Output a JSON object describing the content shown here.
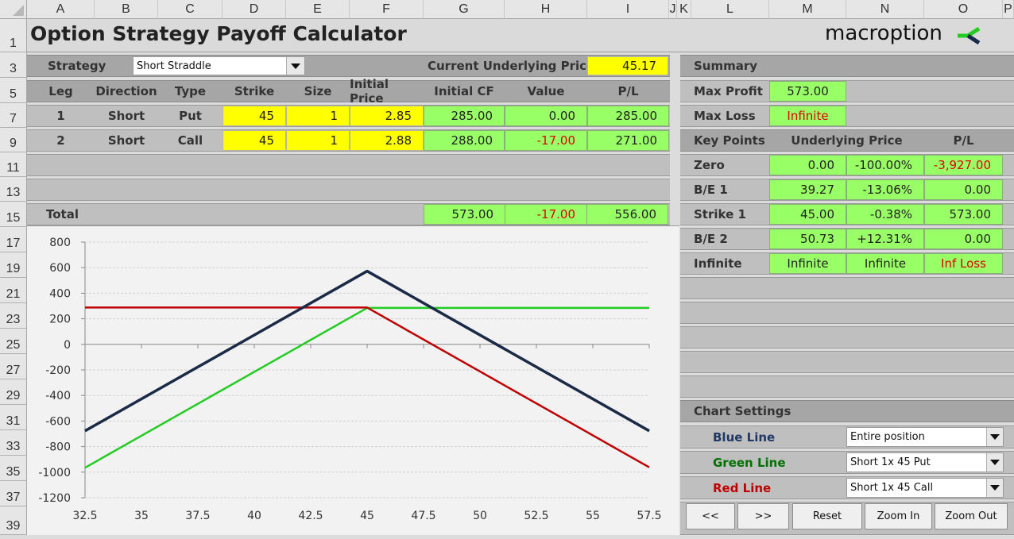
{
  "columns": [
    "A",
    "B",
    "C",
    "D",
    "E",
    "F",
    "G",
    "H",
    "I",
    "J",
    "K",
    "L",
    "M",
    "N",
    "O",
    "P"
  ],
  "rows": [
    "1",
    "3",
    "5",
    "7",
    "9",
    "11",
    "13",
    "15",
    "17",
    "19",
    "21",
    "23",
    "25",
    "27",
    "29",
    "31",
    "33",
    "35",
    "37",
    "39"
  ],
  "title": "Option Strategy Payoff Calculator",
  "logo": {
    "text": "macroption",
    "icon": "macroption-check-icon",
    "colors": {
      "green": "#22cc22",
      "navy": "#1a2a4a"
    }
  },
  "strategy": {
    "label": "Strategy",
    "value": "Short Straddle"
  },
  "underlying": {
    "label": "Current Underlying Price",
    "value": "45.17"
  },
  "legs_table": {
    "headers": [
      "Leg",
      "Direction",
      "Type",
      "Strike",
      "Size",
      "Initial Price",
      "Initial CF",
      "Value",
      "P/L"
    ],
    "rows": [
      {
        "leg": "1",
        "direction": "Short",
        "type": "Put",
        "strike": "45",
        "size": "1",
        "initial_price": "2.85",
        "initial_cf": "285.00",
        "value": "0.00",
        "pl": "285.00"
      },
      {
        "leg": "2",
        "direction": "Short",
        "type": "Call",
        "strike": "45",
        "size": "1",
        "initial_price": "2.88",
        "initial_cf": "288.00",
        "value": "-17.00",
        "pl": "271.00"
      }
    ],
    "total": {
      "label": "Total",
      "initial_cf": "573.00",
      "value": "-17.00",
      "pl": "556.00"
    }
  },
  "summary": {
    "label": "Summary",
    "max_profit": {
      "label": "Max Profit",
      "value": "573.00"
    },
    "max_loss": {
      "label": "Max Loss",
      "value": "Infinite"
    }
  },
  "key_points": {
    "headers": [
      "Key Points",
      "Underlying Price",
      "P/L"
    ],
    "rows": [
      {
        "label": "Zero",
        "price": "0.00",
        "pct": "-100.00%",
        "pl": "-3,927.00"
      },
      {
        "label": "B/E 1",
        "price": "39.27",
        "pct": "-13.06%",
        "pl": "0.00"
      },
      {
        "label": "Strike 1",
        "price": "45.00",
        "pct": "-0.38%",
        "pl": "573.00"
      },
      {
        "label": "B/E 2",
        "price": "50.73",
        "pct": "+12.31%",
        "pl": "0.00"
      },
      {
        "label": "Infinite",
        "price": "Infinite",
        "pct": "Infinite",
        "pl": "Inf Loss"
      }
    ]
  },
  "chart_settings": {
    "label": "Chart Settings",
    "lines": [
      {
        "label": "Blue Line",
        "value": "Entire position",
        "color": "#1f3864"
      },
      {
        "label": "Green Line",
        "value": "Short 1x 45 Put",
        "color": "#007000"
      },
      {
        "label": "Red Line",
        "value": "Short 1x 45 Call",
        "color": "#c00000"
      }
    ],
    "buttons": [
      "<<",
      ">>",
      "Reset",
      "Zoom In",
      "Zoom Out"
    ]
  },
  "chart_data": {
    "type": "line",
    "title": "",
    "xlabel": "",
    "ylabel": "",
    "x_ticks": [
      "32.5",
      "35",
      "37.5",
      "40",
      "42.5",
      "45",
      "47.5",
      "50",
      "52.5",
      "55",
      "57.5"
    ],
    "y_ticks": [
      "800",
      "600",
      "400",
      "200",
      "0",
      "-200",
      "-400",
      "-600",
      "-800",
      "-1000",
      "-1200"
    ],
    "xlim": [
      32.5,
      57.5
    ],
    "ylim": [
      -1200,
      800
    ],
    "grid": true,
    "series": [
      {
        "name": "Entire position",
        "color": "#1b2a47",
        "x": [
          32.5,
          45,
          57.5
        ],
        "y": [
          -677,
          573,
          -677
        ]
      },
      {
        "name": "Short 1x 45 Put",
        "color": "#22cc22",
        "x": [
          32.5,
          45,
          57.5
        ],
        "y": [
          -965,
          285,
          285
        ]
      },
      {
        "name": "Short 1x 45 Call",
        "color": "#c00000",
        "x": [
          32.5,
          45,
          57.5
        ],
        "y": [
          288,
          288,
          -962
        ]
      }
    ]
  }
}
